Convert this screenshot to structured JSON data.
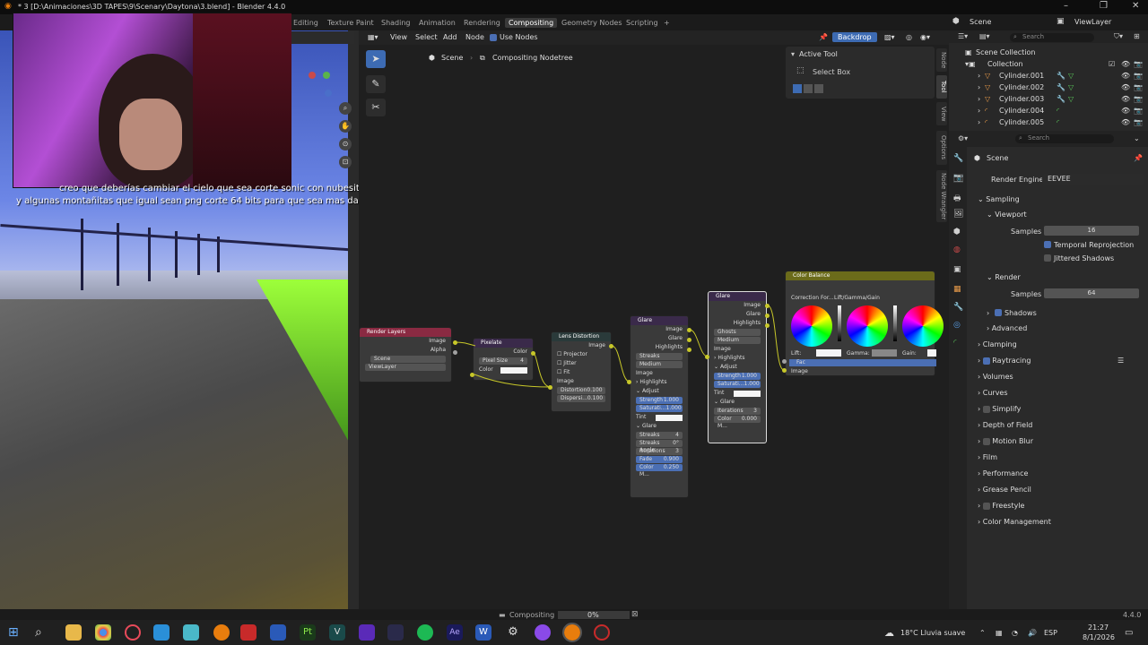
{
  "window": {
    "title": "* 3 [D:\\Animaciones\\3D TAPES\\9\\Scenary\\Daytona\\3.blend] - Blender 4.4.0"
  },
  "workspaces": [
    "Editing",
    "Texture Paint",
    "Shading",
    "Animation",
    "Rendering",
    "Compositing",
    "Geometry Nodes",
    "Scripting",
    "+"
  ],
  "top_right": {
    "scene": "Scene",
    "view_layer": "ViewLayer"
  },
  "chat": {
    "line1": "creo que deberías cambiar el cielo que sea corte sonic con nubesitas pixel",
    "line2": "y algunas montañitas que igual sean png corte 64 bits para que sea mas daytonaaaa"
  },
  "node_header": {
    "menus": [
      "View",
      "Select",
      "Add",
      "Node"
    ],
    "use_nodes": "Use Nodes",
    "backdrop": "Backdrop"
  },
  "breadcrumb": {
    "scene": "Scene",
    "tree": "Compositing Nodetree"
  },
  "active_tool": {
    "title": "Active Tool",
    "tool": "Select Box"
  },
  "side_tabs": [
    "Node",
    "Tool",
    "View",
    "Options",
    "Node Wrangler"
  ],
  "nodes": {
    "render_layers": {
      "title": "Render Layers",
      "out1": "Image",
      "out2": "Alpha",
      "scene": "Scene",
      "layer": "ViewLayer"
    },
    "pixelate": {
      "title": "Pixelate",
      "out": "Color",
      "size_label": "Pixel Size",
      "size": "4",
      "in": "Color"
    },
    "lens": {
      "title": "Lens Distortion",
      "out": "Image",
      "p": "Projector",
      "j": "Jitter",
      "f": "Fit",
      "in": "Image",
      "d_label": "Distortion",
      "d": "0.100",
      "dp_label": "Dispersi...",
      "dp": "0.100"
    },
    "glare1": {
      "title": "Glare",
      "o1": "Image",
      "o2": "Glare",
      "o3": "Highlights",
      "t1": "Streaks",
      "t2": "Medium",
      "in": "Image",
      "hl": "Highlights",
      "adj": "Adjust",
      "s_label": "Strength",
      "s": "1.000",
      "sat_label": "Saturati...",
      "sat": "1.000",
      "tint": "Tint",
      "g": "Glare",
      "st_label": "Streaks",
      "st": "4",
      "sa_label": "Streaks Angle",
      "sa": "0°",
      "it_label": "Iterations",
      "it": "3",
      "fd_label": "Fade",
      "fd": "0.900",
      "cm_label": "Color M...",
      "cm": "0.250"
    },
    "glare2": {
      "title": "Glare",
      "o1": "Image",
      "o2": "Glare",
      "o3": "Highlights",
      "t1": "Ghosts",
      "t2": "Medium",
      "in": "Image",
      "hl": "Highlights",
      "adj": "Adjust",
      "s_label": "Strength",
      "s": "1.000",
      "sat_label": "Saturati...",
      "sat": "1.000",
      "tint": "Tint",
      "g": "Glare",
      "it_label": "Iterations",
      "it": "3",
      "cm_label": "Color M...",
      "cm": "0.000"
    },
    "color_balance": {
      "title": "Color Balance",
      "cf": "Correction For...",
      "mode": "Lift/Gamma/Gain",
      "lift": "Lift:",
      "gamma": "Gamma:",
      "gain": "Gain:",
      "fac": "Fac",
      "in": "Image"
    }
  },
  "outliner": {
    "root": "Scene Collection",
    "collection": "Collection",
    "items": [
      "Cylinder.001",
      "Cylinder.002",
      "Cylinder.003",
      "Cylinder.004",
      "Cylinder.005"
    ]
  },
  "properties": {
    "scene": "Scene",
    "render_engine_label": "Render Engine",
    "render_engine": "EEVEE",
    "sampling": "Sampling",
    "viewport": "Viewport",
    "samples_label": "Samples",
    "viewport_samples": "16",
    "temporal": "Temporal Reprojection",
    "jittered": "Jittered Shadows",
    "render": "Render",
    "render_samples": "64",
    "shadows": "Shadows",
    "advanced": "Advanced",
    "panels": [
      "Clamping",
      "Raytracing",
      "Volumes",
      "Curves",
      "Simplify",
      "Depth of Field",
      "Motion Blur",
      "Film",
      "Performance",
      "Grease Pencil",
      "Freestyle",
      "Color Management"
    ]
  },
  "status": {
    "task": "Compositing",
    "progress": "0%",
    "version": "4.4.0",
    "progress_fraction": 0
  },
  "taskbar": {
    "weather": "18°C  Lluvia suave",
    "lang": "ESP",
    "time": "21:27",
    "date": "8/1/2026"
  },
  "colors": {
    "accent": "#3d6bb3",
    "socket_yellow": "#c7c729",
    "node_color_head": "#6b2a55",
    "glare_head": "#3a2a4a",
    "filter_head": "#2a3a3a",
    "cb_head": "#6b6b1a"
  }
}
